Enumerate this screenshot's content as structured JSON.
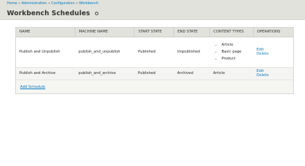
{
  "breadcrumb": {
    "items": [
      "Home",
      "Administration",
      "Configuration",
      "Workbench"
    ],
    "separator": "»"
  },
  "page_title": "Workbench Schedules",
  "table": {
    "headers": [
      "NAME",
      "MACHINE NAME",
      "START STATE",
      "END STATE",
      "CONTENT TYPES",
      "OPERATIONS"
    ],
    "rows": [
      {
        "name": "Publish and Unpublish",
        "machine_name": "publish_and_unpublish",
        "start_state": "Published",
        "end_state": "Unpublished",
        "content_types": [
          "Article",
          "Basic page",
          "Product"
        ],
        "edit": "Edit",
        "delete": "Delete"
      },
      {
        "name": "Publish and Archive",
        "machine_name": "publish_and_archive",
        "start_state": "Published",
        "end_state": "Archived",
        "content_types_text": "Article",
        "edit": "Edit",
        "delete": "Delete"
      }
    ]
  },
  "add_link": "Add Schedule",
  "colors": {
    "link": "#0074bd",
    "header_bg": "#e1e2dc",
    "panel_bg": "#f5f5f2"
  },
  "icons": {
    "title_icon": "gear-icon"
  }
}
